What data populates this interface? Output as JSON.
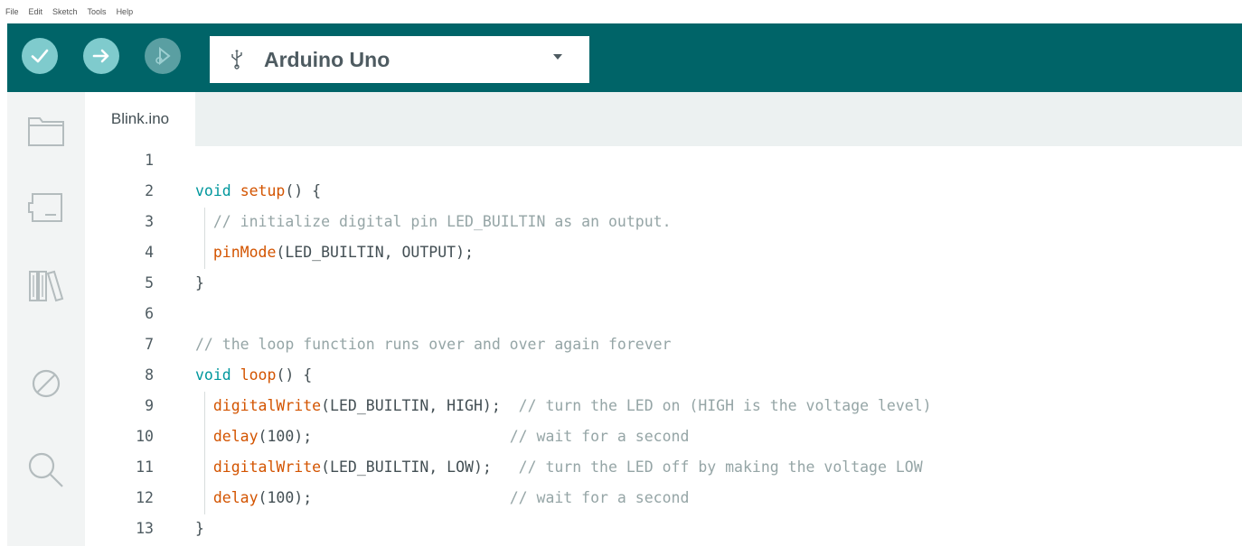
{
  "menu": [
    "File",
    "Edit",
    "Sketch",
    "Tools",
    "Help"
  ],
  "toolbar": {
    "verify_icon": "checkmark-icon",
    "upload_icon": "arrow-right-icon",
    "debug_icon": "debug-icon",
    "board_name": "Arduino Uno",
    "usb_icon": "usb-icon",
    "colors": {
      "toolbar_bg": "#006468",
      "button": "#7fcbcd"
    }
  },
  "sidebar": {
    "items": [
      {
        "icon": "folder-icon"
      },
      {
        "icon": "board-manager-icon"
      },
      {
        "icon": "library-icon"
      },
      {
        "icon": "debug-off-icon"
      },
      {
        "icon": "search-icon"
      }
    ]
  },
  "tabs": [
    {
      "label": "Blink.ino"
    }
  ],
  "editor": {
    "lines": [
      {
        "num": "1",
        "tokens": []
      },
      {
        "num": "2",
        "tokens": [
          {
            "t": "kw",
            "v": "void"
          },
          {
            "t": "p",
            "v": " "
          },
          {
            "t": "fn",
            "v": "setup"
          },
          {
            "t": "p",
            "v": "() {"
          }
        ]
      },
      {
        "num": "3",
        "tokens": [
          {
            "t": "p",
            "v": "  "
          },
          {
            "t": "cm",
            "v": "// initialize digital pin LED_BUILTIN as an output."
          }
        ]
      },
      {
        "num": "4",
        "tokens": [
          {
            "t": "p",
            "v": "  "
          },
          {
            "t": "fn",
            "v": "pinMode"
          },
          {
            "t": "p",
            "v": "(LED_BUILTIN, OUTPUT);"
          }
        ]
      },
      {
        "num": "5",
        "tokens": [
          {
            "t": "p",
            "v": "}"
          }
        ]
      },
      {
        "num": "6",
        "tokens": []
      },
      {
        "num": "7",
        "tokens": [
          {
            "t": "cm",
            "v": "// the loop function runs over and over again forever"
          }
        ]
      },
      {
        "num": "8",
        "tokens": [
          {
            "t": "kw",
            "v": "void"
          },
          {
            "t": "p",
            "v": " "
          },
          {
            "t": "fn",
            "v": "loop"
          },
          {
            "t": "p",
            "v": "() {"
          }
        ]
      },
      {
        "num": "9",
        "tokens": [
          {
            "t": "p",
            "v": "  "
          },
          {
            "t": "fn",
            "v": "digitalWrite"
          },
          {
            "t": "p",
            "v": "(LED_BUILTIN, HIGH);  "
          },
          {
            "t": "cm",
            "v": "// turn the LED on (HIGH is the voltage level)"
          }
        ]
      },
      {
        "num": "10",
        "tokens": [
          {
            "t": "p",
            "v": "  "
          },
          {
            "t": "fn",
            "v": "delay"
          },
          {
            "t": "p",
            "v": "(100);                      "
          },
          {
            "t": "cm",
            "v": "// wait for a second"
          }
        ]
      },
      {
        "num": "11",
        "tokens": [
          {
            "t": "p",
            "v": "  "
          },
          {
            "t": "fn",
            "v": "digitalWrite"
          },
          {
            "t": "p",
            "v": "(LED_BUILTIN, LOW);   "
          },
          {
            "t": "cm",
            "v": "// turn the LED off by making the voltage LOW"
          }
        ]
      },
      {
        "num": "12",
        "tokens": [
          {
            "t": "p",
            "v": "  "
          },
          {
            "t": "fn",
            "v": "delay"
          },
          {
            "t": "p",
            "v": "(100);                      "
          },
          {
            "t": "cm",
            "v": "// wait for a second"
          }
        ]
      },
      {
        "num": "13",
        "tokens": [
          {
            "t": "p",
            "v": "}"
          }
        ]
      }
    ]
  }
}
